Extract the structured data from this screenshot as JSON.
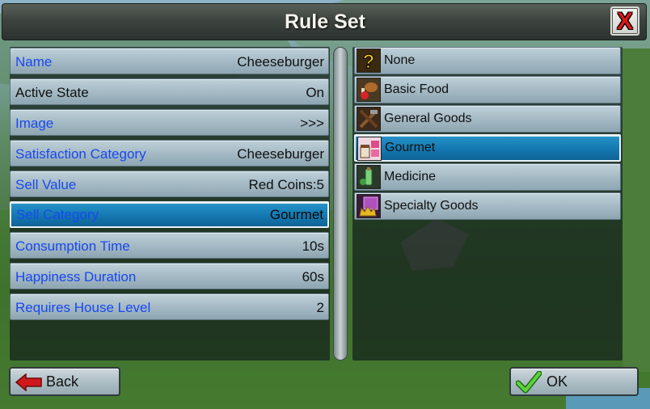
{
  "window": {
    "title": "Rule Set",
    "close_symbol": "X"
  },
  "properties": [
    {
      "label": "Name",
      "value": "Cheeseburger",
      "link": true,
      "selected": false
    },
    {
      "label": "Active State",
      "value": "On",
      "link": false,
      "selected": false
    },
    {
      "label": "Image",
      "value": ">>>",
      "link": true,
      "selected": false
    },
    {
      "label": "Satisfaction Category",
      "value": "Cheeseburger",
      "link": true,
      "selected": false
    },
    {
      "label": "Sell Value",
      "value": "Red Coins:5",
      "link": true,
      "selected": false
    },
    {
      "label": "Sell Category",
      "value": "Gourmet",
      "link": true,
      "selected": true
    },
    {
      "label": "Consumption Time",
      "value": "10s",
      "link": true,
      "selected": false
    },
    {
      "label": "Happiness Duration",
      "value": "60s",
      "link": true,
      "selected": false
    },
    {
      "label": "Requires House Level",
      "value": "2",
      "link": true,
      "selected": false
    }
  ],
  "categories": [
    {
      "label": "None",
      "icon": "question-mark-icon",
      "selected": false
    },
    {
      "label": "Basic Food",
      "icon": "basic-food-icon",
      "selected": false
    },
    {
      "label": "General Goods",
      "icon": "general-goods-icon",
      "selected": false
    },
    {
      "label": "Gourmet",
      "icon": "gourmet-icon",
      "selected": true
    },
    {
      "label": "Medicine",
      "icon": "medicine-icon",
      "selected": false
    },
    {
      "label": "Specialty Goods",
      "icon": "specialty-goods-icon",
      "selected": false
    }
  ],
  "buttons": {
    "back_label": "Back",
    "back_icon": "back-arrow-icon",
    "ok_label": "OK",
    "ok_icon": "checkmark-icon"
  },
  "colors": {
    "link_text": "#1848f0",
    "selected_row": "#1478b0",
    "close_x": "#d81818"
  }
}
